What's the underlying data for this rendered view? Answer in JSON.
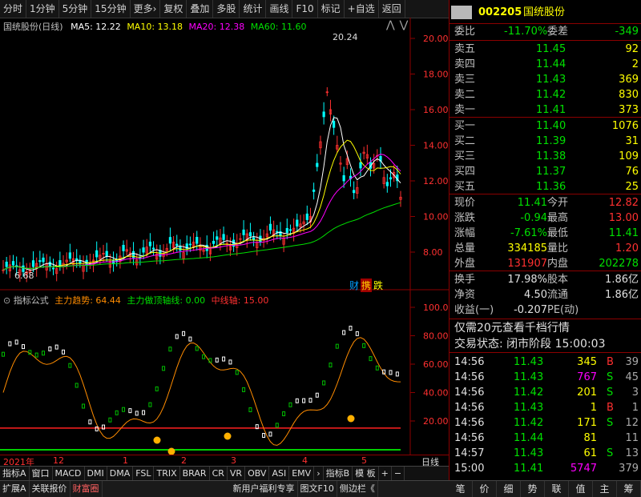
{
  "toolbar": {
    "items": [
      "分时",
      "1分钟",
      "5分钟",
      "15分钟",
      "更多›",
      "复权",
      "叠加",
      "多股",
      "统计",
      "画线",
      "F10",
      "标记",
      "+自选",
      "返回"
    ]
  },
  "main_legend": {
    "title": "国统股份(日线)",
    "ma5": "MA5: 12.22",
    "ma10": "MA10: 13.18",
    "ma20": "MA20: 12.38",
    "ma60": "MA60: 11.60",
    "high_label": "20.24",
    "low_label": "6.68"
  },
  "price_axis": [
    "20.00",
    "18.00",
    "16.00",
    "14.00",
    "12.00",
    "10.00",
    "8.00"
  ],
  "badges": {
    "cai": "财",
    "yi": "携",
    "diao": "跌"
  },
  "indicator": {
    "title": "指标公式",
    "trend": "主力趋势: 64.44",
    "top_line": "主力做顶轴线: 0.00",
    "mid_line": "中线轴: 15.00",
    "axis": [
      "100.0",
      "80.00",
      "60.00",
      "40.00",
      "20.00"
    ]
  },
  "time_axis": {
    "labels": [
      "2021年",
      "12",
      "1",
      "2",
      "3",
      "4",
      "5"
    ],
    "right_label": "日线"
  },
  "tabs_row1": [
    "指标A",
    "窗口",
    "MACD",
    "DMI",
    "DMA",
    "FSL",
    "TRIX",
    "BRAR",
    "CR",
    "VR",
    "OBV",
    "ASI",
    "EMV",
    "›",
    "指标B",
    "模 板",
    "+",
    "−"
  ],
  "tabs_row2": [
    "扩展A",
    "关联报价",
    "财富圈",
    "新用户福利专享",
    "图文F10",
    "侧边栏《"
  ],
  "right_tabs": [
    "笔",
    "价",
    "细",
    "势",
    "联",
    "值",
    "主",
    "筹"
  ],
  "quote": {
    "code": "002205",
    "name": "国统股份",
    "weibi_label": "委比",
    "weibi": "-11.70%",
    "weicha_label": "委差",
    "weicha": "-349",
    "asks": [
      {
        "label": "卖五",
        "price": "11.45",
        "vol": "92"
      },
      {
        "label": "卖四",
        "price": "11.44",
        "vol": "2"
      },
      {
        "label": "卖三",
        "price": "11.43",
        "vol": "369"
      },
      {
        "label": "卖二",
        "price": "11.42",
        "vol": "830"
      },
      {
        "label": "卖一",
        "price": "11.41",
        "vol": "373"
      }
    ],
    "bids": [
      {
        "label": "买一",
        "price": "11.40",
        "vol": "1076"
      },
      {
        "label": "买二",
        "price": "11.39",
        "vol": "31"
      },
      {
        "label": "买三",
        "price": "11.38",
        "vol": "109"
      },
      {
        "label": "买四",
        "price": "11.37",
        "vol": "76"
      },
      {
        "label": "买五",
        "price": "11.36",
        "vol": "25"
      }
    ],
    "stats": [
      {
        "l1": "现价",
        "v1": "11.41",
        "c1": "#00e000",
        "l2": "今开",
        "v2": "12.82",
        "c2": "#ff3030"
      },
      {
        "l1": "涨跌",
        "v1": "-0.94",
        "c1": "#00e000",
        "l2": "最高",
        "v2": "13.00",
        "c2": "#ff3030"
      },
      {
        "l1": "涨幅",
        "v1": "-7.61%",
        "c1": "#00e000",
        "l2": "最低",
        "v2": "11.41",
        "c2": "#00e000"
      },
      {
        "l1": "总量",
        "v1": "334185",
        "c1": "#ffff00",
        "l2": "量比",
        "v2": "1.20",
        "c2": "#ff3030"
      },
      {
        "l1": "外盘",
        "v1": "131907",
        "c1": "#ff3030",
        "l2": "内盘",
        "v2": "202278",
        "c2": "#00e000"
      }
    ],
    "stats2": [
      {
        "l1": "换手",
        "v1": "17.98%",
        "l2": "股本",
        "v2": "1.86亿"
      },
      {
        "l1": "净资",
        "v1": "4.50",
        "l2": "流通",
        "v2": "1.86亿"
      },
      {
        "l1": "收益(一)",
        "v1": "-0.207",
        "l2": "PE(动)",
        "v2": ""
      }
    ],
    "promo": "仅需20元查看千档行情",
    "trade_status": "交易状态: 闭市阶段 15:00:03",
    "ticks": [
      {
        "t": "14:56",
        "p": "11.43",
        "v": "345",
        "vc": "#ffff00",
        "bs": "B",
        "bc": "#ff3030",
        "n": "39"
      },
      {
        "t": "14:56",
        "p": "11.43",
        "v": "767",
        "vc": "#ff00ff",
        "bs": "S",
        "bc": "#00e000",
        "n": "45"
      },
      {
        "t": "14:56",
        "p": "11.42",
        "v": "201",
        "vc": "#ffff00",
        "bs": "S",
        "bc": "#00e000",
        "n": "3"
      },
      {
        "t": "14:56",
        "p": "11.43",
        "v": "1",
        "vc": "#ffff00",
        "bs": "B",
        "bc": "#ff3030",
        "n": "1"
      },
      {
        "t": "14:56",
        "p": "11.42",
        "v": "171",
        "vc": "#ffff00",
        "bs": "S",
        "bc": "#00e000",
        "n": "12"
      },
      {
        "t": "14:56",
        "p": "11.44",
        "v": "81",
        "vc": "#ffff00",
        "bs": "",
        "bc": "#00e000",
        "n": "11"
      },
      {
        "t": "14:57",
        "p": "11.43",
        "v": "61",
        "vc": "#ffff00",
        "bs": "S",
        "bc": "#00e000",
        "n": "13"
      },
      {
        "t": "15:00",
        "p": "11.41",
        "v": "5747",
        "vc": "#ff00ff",
        "bs": "",
        "bc": "#00e000",
        "n": "379"
      }
    ]
  }
}
